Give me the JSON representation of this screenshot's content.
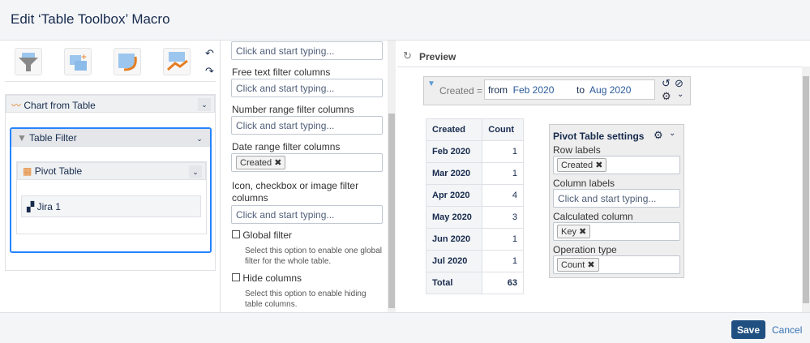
{
  "title": "Edit ‘Table Toolbox’ Macro",
  "left": {
    "chart_from_table": "Chart from Table",
    "table_filter": "Table Filter",
    "pivot_table": "Pivot Table",
    "jira": "Jira 1"
  },
  "middle": {
    "placeholder": "Click and start typing...",
    "free_text_label": "Free text filter columns",
    "number_range_label": "Number range filter columns",
    "date_range_label": "Date range filter columns",
    "date_range_tag": "Created",
    "icon_label": "Icon, checkbox or image filter columns",
    "global_filter": "Global filter",
    "global_filter_help": "Select this option to enable one global filter for the whole table.",
    "hide_columns": "Hide columns",
    "hide_columns_help": "Select this option to enable hiding table columns."
  },
  "preview": {
    "title": "Preview",
    "filter": {
      "label": "Created =",
      "from": "from",
      "from_val": "Feb 2020",
      "to": "to",
      "to_val": "Aug 2020"
    },
    "table": {
      "headers": [
        "Created",
        "Count"
      ],
      "rows": [
        [
          "Feb 2020",
          "1"
        ],
        [
          "Mar 2020",
          "1"
        ],
        [
          "Apr 2020",
          "4"
        ],
        [
          "May 2020",
          "3"
        ],
        [
          "Jun 2020",
          "1"
        ],
        [
          "Jul 2020",
          "1"
        ],
        [
          "Total",
          "63"
        ]
      ]
    },
    "pivot": {
      "title": "Pivot Table settings",
      "row_labels": "Row labels",
      "row_tag": "Created",
      "column_labels": "Column labels",
      "column_placeholder": "Click and start typing...",
      "calc_col": "Calculated column",
      "calc_tag": "Key",
      "op_type": "Operation type",
      "op_tag": "Count"
    }
  },
  "footer": {
    "save": "Save",
    "cancel": "Cancel"
  }
}
